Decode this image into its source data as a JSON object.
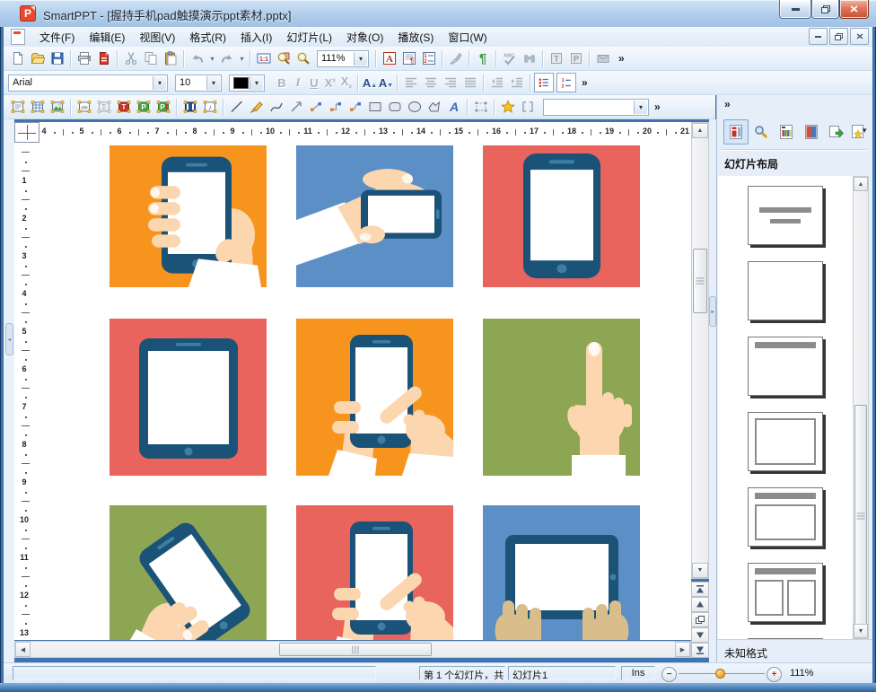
{
  "window": {
    "title": "SmartPPT - [握持手机pad触摸演示ppt素材.pptx]",
    "app_initial": "P"
  },
  "menu": {
    "items": [
      {
        "key": "file",
        "label": "文件(F)"
      },
      {
        "key": "edit",
        "label": "编辑(E)"
      },
      {
        "key": "view",
        "label": "视图(V)"
      },
      {
        "key": "format",
        "label": "格式(R)"
      },
      {
        "key": "insert",
        "label": "插入(I)"
      },
      {
        "key": "slide",
        "label": "幻灯片(L)"
      },
      {
        "key": "object",
        "label": "对象(O)"
      },
      {
        "key": "play",
        "label": "播放(S)"
      },
      {
        "key": "window",
        "label": "窗口(W)"
      }
    ]
  },
  "toolbars": {
    "zoom_value": "111%",
    "font_name": "Arial",
    "font_size": "10",
    "overflow": "»",
    "glyphs": {
      "zoom_actual": "1:1",
      "font_color": "A",
      "pilcrow": "¶",
      "spellcheck": "ABC",
      "bold": "B",
      "italic": "I",
      "underline": "U",
      "superscript": "X",
      "subscript": "X",
      "grow_font": "A",
      "shrink_font": "A",
      "num1": "1",
      "num2": "2",
      "ole": "ole",
      "fontwork": "A"
    }
  },
  "ruler": {
    "horizontal": [
      "4",
      "5",
      "6",
      "7",
      "8",
      "9",
      "10",
      "11",
      "12",
      "13",
      "14",
      "15",
      "16",
      "17",
      "18",
      "19",
      "20",
      "21"
    ],
    "vertical": [
      "1",
      "2",
      "3",
      "4",
      "5",
      "6",
      "7",
      "8",
      "9",
      "10",
      "11",
      "12",
      "13"
    ]
  },
  "colors": {
    "phone_body": "#1A5377",
    "phone_detail": "#3E7EA5",
    "screen": "#FFFFFF",
    "skin": "#FBD6AF",
    "skin_tan": "#D9BE8C",
    "sleeve": "#FFFFFF",
    "accent_orange": "#F7941E",
    "accent_blue": "#5B8FC6",
    "accent_red": "#E8645C",
    "accent_green": "#8CA653"
  },
  "canvas": {
    "tiles": [
      {
        "name": "hand-holding-phone",
        "type": "hand-phone-portrait",
        "bg": "#F7941E"
      },
      {
        "name": "hand-holding-phone-landscape",
        "type": "hand-phone-landscape",
        "bg": "#5B8FC6"
      },
      {
        "name": "smartphone-portrait",
        "type": "phone-portrait",
        "bg": "#E8645C"
      },
      {
        "name": "tablet-portrait",
        "type": "tablet-portrait",
        "bg": "#E8645C"
      },
      {
        "name": "finger-touching-phone",
        "type": "phone-touch",
        "bg": "#F7941E"
      },
      {
        "name": "pointing-finger",
        "type": "pointing-finger",
        "bg": "#8CA653"
      },
      {
        "name": "hand-holding-phone-tilted",
        "type": "hand-phone-tilted",
        "bg": "#8CA653"
      },
      {
        "name": "finger-touching-phone-red",
        "type": "phone-touch",
        "bg": "#E8645C"
      },
      {
        "name": "hands-holding-tablet",
        "type": "two-hands-tablet",
        "bg": "#5B8FC6"
      }
    ]
  },
  "sidebar": {
    "overflow": "»",
    "title": "幻灯片布局",
    "status": "未知格式",
    "layouts": [
      {
        "type": "title-subtitle"
      },
      {
        "type": "blank"
      },
      {
        "type": "title-only"
      },
      {
        "type": "content-frame"
      },
      {
        "type": "title-content"
      },
      {
        "type": "title-two-content"
      },
      {
        "type": "blank-partial"
      }
    ]
  },
  "statusbar": {
    "slide_position": "第 1 个幻灯片，共",
    "slide_name": "幻灯片1",
    "insert_mode": "Ins",
    "zoom": "111%"
  }
}
